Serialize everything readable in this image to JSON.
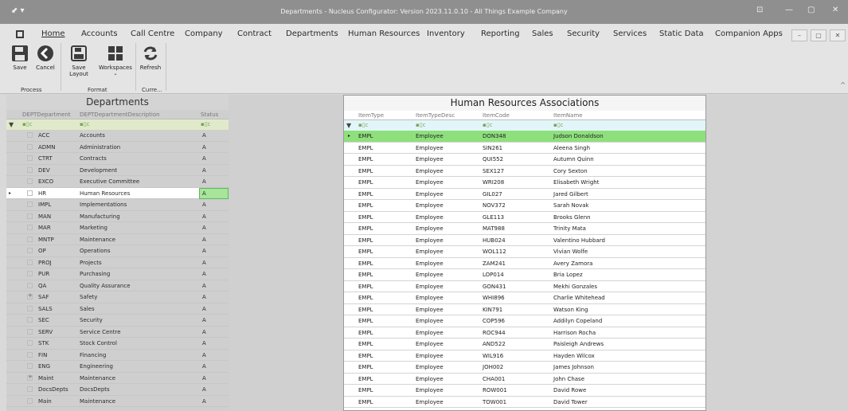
{
  "window": {
    "title": "Departments - Nucleus Configurator: Version 2023.11.0.10 - All Things Example Company",
    "quick_access": "⬋ ▾",
    "controls": {
      "pin": "⊡",
      "min": "—",
      "max": "▢",
      "close": "✕"
    }
  },
  "menu": {
    "tabs": [
      "Home",
      "Accounts",
      "Call Centre",
      "Company",
      "Contract",
      "Departments",
      "Human Resources",
      "Inventory",
      "Reporting",
      "Sales",
      "Security",
      "Services",
      "Static Data",
      "Companion Apps"
    ],
    "active": "Home",
    "mdi": {
      "min": "–",
      "restore": "▢",
      "close": "✕"
    }
  },
  "ribbon": {
    "buttons": {
      "save": "Save",
      "cancel": "Cancel",
      "save_layout": "Save Layout",
      "workspaces": "Workspaces",
      "refresh": "Refresh"
    },
    "groups": {
      "process": "Process",
      "format": "Format",
      "current": "Curre..."
    },
    "collapse": "^"
  },
  "departments": {
    "title": "Departments",
    "columns": [
      "DEPTDepartment",
      "DEPTDepartmentDescription",
      "Status"
    ],
    "rows": [
      [
        "ACC",
        "Accounts",
        "A"
      ],
      [
        "ADMN",
        "Administration",
        "A"
      ],
      [
        "CTRT",
        "Contracts",
        "A"
      ],
      [
        "DEV",
        "Development",
        "A"
      ],
      [
        "EXCO",
        "Executive Committee",
        "A"
      ],
      [
        "HR",
        "Human Resources",
        "A"
      ],
      [
        "IMPL",
        "Implementations",
        "A"
      ],
      [
        "MAN",
        "Manufacturing",
        "A"
      ],
      [
        "MAR",
        "Marketing",
        "A"
      ],
      [
        "MNTP",
        "Maintenance",
        "A"
      ],
      [
        "OP",
        "Operations",
        "A"
      ],
      [
        "PROJ",
        "Projects",
        "A"
      ],
      [
        "PUR",
        "Purchasing",
        "A"
      ],
      [
        "QA",
        "Quality Assurance",
        "A"
      ],
      [
        "SAF",
        "Safety",
        "A"
      ],
      [
        "SALS",
        "Sales",
        "A"
      ],
      [
        "SEC",
        "Security",
        "A"
      ],
      [
        "SERV",
        "Service Centre",
        "A"
      ],
      [
        "STK",
        "Stock Control",
        "A"
      ],
      [
        "FIN",
        "Financing",
        "A"
      ],
      [
        "ENG",
        "Engineering",
        "A"
      ],
      [
        "Maint",
        "Maintenance",
        "A"
      ],
      [
        "DocsDepts",
        "DocsDepts",
        "A"
      ],
      [
        "Main",
        "Maintenance",
        "A"
      ]
    ],
    "expandable": [
      "SAF",
      "Maint"
    ],
    "selected": "HR"
  },
  "associations": {
    "title": "Human Resources Associations",
    "columns": [
      "ItemType",
      "ItemTypeDesc",
      "ItemCode",
      "ItemName"
    ],
    "rows": [
      [
        "EMPL",
        "Employee",
        "DON348",
        "Judson Donaldson"
      ],
      [
        "EMPL",
        "Employee",
        "SIN261",
        "Aleena Singh"
      ],
      [
        "EMPL",
        "Employee",
        "QUI552",
        "Autumn Quinn"
      ],
      [
        "EMPL",
        "Employee",
        "SEX127",
        "Cory Sexton"
      ],
      [
        "EMPL",
        "Employee",
        "WRI208",
        "Elisabeth Wright"
      ],
      [
        "EMPL",
        "Employee",
        "GIL027",
        "Jared Gilbert"
      ],
      [
        "EMPL",
        "Employee",
        "NOV372",
        "Sarah Novak"
      ],
      [
        "EMPL",
        "Employee",
        "GLE113",
        "Brooks Glenn"
      ],
      [
        "EMPL",
        "Employee",
        "MAT988",
        "Trinity Mata"
      ],
      [
        "EMPL",
        "Employee",
        "HUB024",
        "Valentino Hubbard"
      ],
      [
        "EMPL",
        "Employee",
        "WOL112",
        "Vivian Wolfe"
      ],
      [
        "EMPL",
        "Employee",
        "ZAM241",
        "Avery Zamora"
      ],
      [
        "EMPL",
        "Employee",
        "LOP014",
        "Bria Lopez"
      ],
      [
        "EMPL",
        "Employee",
        "GON431",
        "Mekhi Gonzales"
      ],
      [
        "EMPL",
        "Employee",
        "WHI896",
        "Charlie Whitehead"
      ],
      [
        "EMPL",
        "Employee",
        "KIN791",
        "Watson King"
      ],
      [
        "EMPL",
        "Employee",
        "COP596",
        "Addilyn Copeland"
      ],
      [
        "EMPL",
        "Employee",
        "ROC944",
        "Harrison Rocha"
      ],
      [
        "EMPL",
        "Employee",
        "AND522",
        "Paisleigh Andrews"
      ],
      [
        "EMPL",
        "Employee",
        "WIL916",
        "Hayden Wilcox"
      ],
      [
        "EMPL",
        "Employee",
        "JOH002",
        "James Johnson"
      ],
      [
        "EMPL",
        "Employee",
        "CHA001",
        "John Chase"
      ],
      [
        "EMPL",
        "Employee",
        "ROW001",
        "David Rowe"
      ],
      [
        "EMPL",
        "Employee",
        "TOW001",
        "David Tower"
      ]
    ],
    "selected_index": 0
  },
  "glyphs": {
    "filter_funnel": "▼",
    "filter_cell": "▪▯c",
    "row_indicator": "▸"
  },
  "colors": {
    "selection_green": "#8ee07c",
    "status_green": "#a6e59a",
    "filter_row_left": "#e0eaca",
    "filter_row_right": "#e2f6fa"
  }
}
